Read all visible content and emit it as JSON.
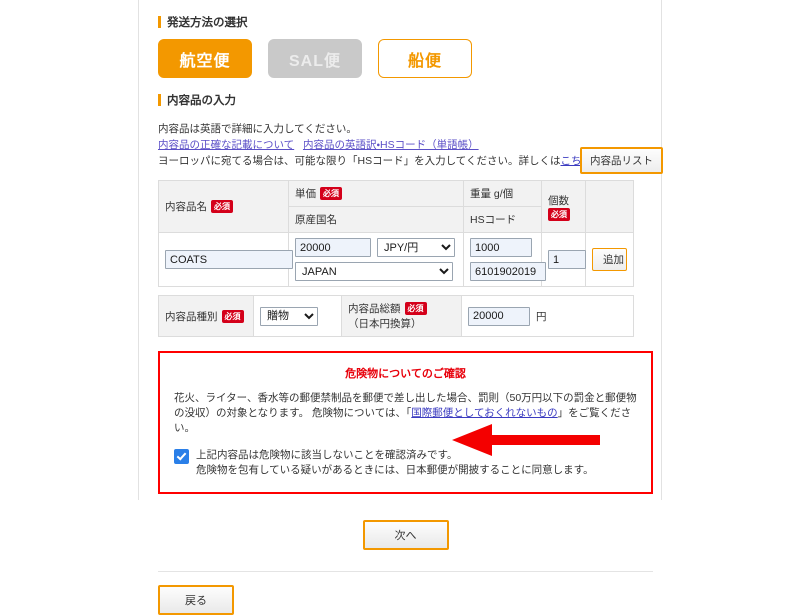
{
  "shipping_section": {
    "heading": "発送方法の選択",
    "options": [
      {
        "label": "航空便",
        "state": "selected"
      },
      {
        "label": "SAL便",
        "state": "disabled"
      },
      {
        "label": "船便",
        "state": "outline"
      }
    ]
  },
  "contents_section": {
    "heading": "内容品の入力",
    "line1": "内容品は英語で詳細に入力してください。",
    "link_accurate": "内容品の正確な記載について",
    "link_english_hs": "内容品の英語訳・HSコード（単語帳）",
    "line3_before": "ヨーロッパに宛てる場合は、可能な限り「HSコード」を入力してください。詳しくは",
    "link_kochira": "こちら",
    "line3_after": "。",
    "list_button": "内容品リスト"
  },
  "item_table": {
    "headers": {
      "name": "内容品名",
      "unit_price": "単価",
      "origin_country": "原産国名",
      "weight": "重量 g/個",
      "hs_code": "HSコード",
      "quantity": "個数"
    },
    "required_badge": "必須",
    "values": {
      "name": "COATS",
      "unit_price": "20000",
      "currency": "JPY/円",
      "weight": "1000",
      "origin_country": "JAPAN",
      "hs_code": "6101902019",
      "quantity": "1"
    },
    "currency_options": [
      "JPY/円"
    ],
    "origin_options": [
      "JAPAN"
    ],
    "add_button": "追加"
  },
  "summary_table": {
    "kind_label": "内容品種別",
    "kind_value": "贈物",
    "kind_options": [
      "贈物"
    ],
    "total_label_line1": "内容品総額",
    "total_label_line2": "（日本円換算）",
    "total_value": "20000",
    "total_unit": "円",
    "required_badge": "必須"
  },
  "danger_box": {
    "title": "危険物についてのご確認",
    "body_before": "花火、ライター、香水等の郵便禁制品を郵便で差し出した場合、罰則（50万円以下の罰金と郵便物の没収）の対象となります。 危険物については、「",
    "body_link": "国際郵便としておくれないもの",
    "body_after": "」をご覧ください。",
    "agree_line1": "上記内容品は危険物に該当しないことを確認済みです。",
    "agree_line2": "危険物を包有している疑いがあるときには、日本郵便が開披することに同意します。",
    "checkbox_checked": true,
    "border_color": "#ff0000",
    "title_color": "#e8000b"
  },
  "footer": {
    "next_button": "次へ",
    "back_button": "戻る"
  },
  "annotation": {
    "arrow_color": "#f40000",
    "arrow_direction": "left"
  },
  "theme": {
    "accent": "#f39800",
    "required_badge_bg": "#d4001a",
    "link_color": "#5b4fc7",
    "input_bg": "#eef3fb"
  }
}
